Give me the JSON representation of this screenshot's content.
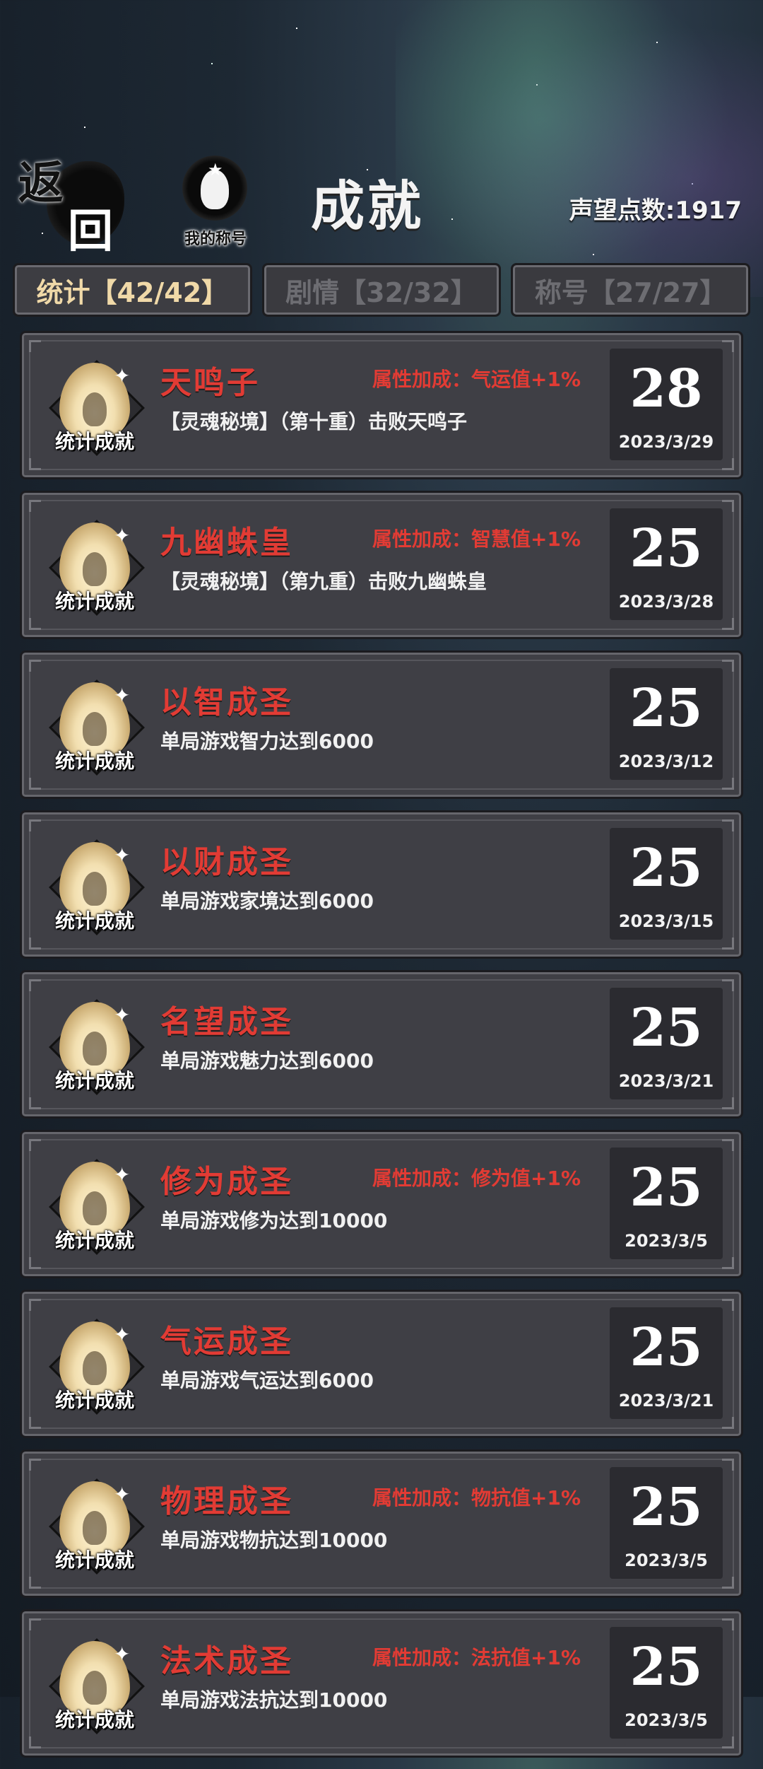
{
  "header": {
    "back_chars": [
      "返",
      "回"
    ],
    "title_badge_label": "我的称号",
    "page_title": "成就",
    "prestige": "声望点数:1917"
  },
  "tabs": [
    {
      "label": "统计【42/42】",
      "active": true
    },
    {
      "label": "剧情【32/32】",
      "active": false
    },
    {
      "label": "称号【27/27】",
      "active": false
    }
  ],
  "emblem_label": "统计成就",
  "achievements": [
    {
      "name": "天鸣子",
      "bonus": "属性加成：气运值+1%",
      "desc": "【灵魂秘境】（第十重）击败天鸣子",
      "score": "28",
      "date": "2023/3/29"
    },
    {
      "name": "九幽蛛皇",
      "bonus": "属性加成：智慧值+1%",
      "desc": "【灵魂秘境】（第九重）击败九幽蛛皇",
      "score": "25",
      "date": "2023/3/28"
    },
    {
      "name": "以智成圣",
      "bonus": "",
      "desc": "单局游戏智力达到6000",
      "score": "25",
      "date": "2023/3/12"
    },
    {
      "name": "以财成圣",
      "bonus": "",
      "desc": "单局游戏家境达到6000",
      "score": "25",
      "date": "2023/3/15"
    },
    {
      "name": "名望成圣",
      "bonus": "",
      "desc": "单局游戏魅力达到6000",
      "score": "25",
      "date": "2023/3/21"
    },
    {
      "name": "修为成圣",
      "bonus": "属性加成：修为值+1%",
      "desc": "单局游戏修为达到10000",
      "score": "25",
      "date": "2023/3/5"
    },
    {
      "name": "气运成圣",
      "bonus": "",
      "desc": "单局游戏气运达到6000",
      "score": "25",
      "date": "2023/3/21"
    },
    {
      "name": "物理成圣",
      "bonus": "属性加成：物抗值+1%",
      "desc": "单局游戏物抗达到10000",
      "score": "25",
      "date": "2023/3/5"
    },
    {
      "name": "法术成圣",
      "bonus": "属性加成：法抗值+1%",
      "desc": "单局游戏法抗达到10000",
      "score": "25",
      "date": "2023/3/5"
    }
  ]
}
